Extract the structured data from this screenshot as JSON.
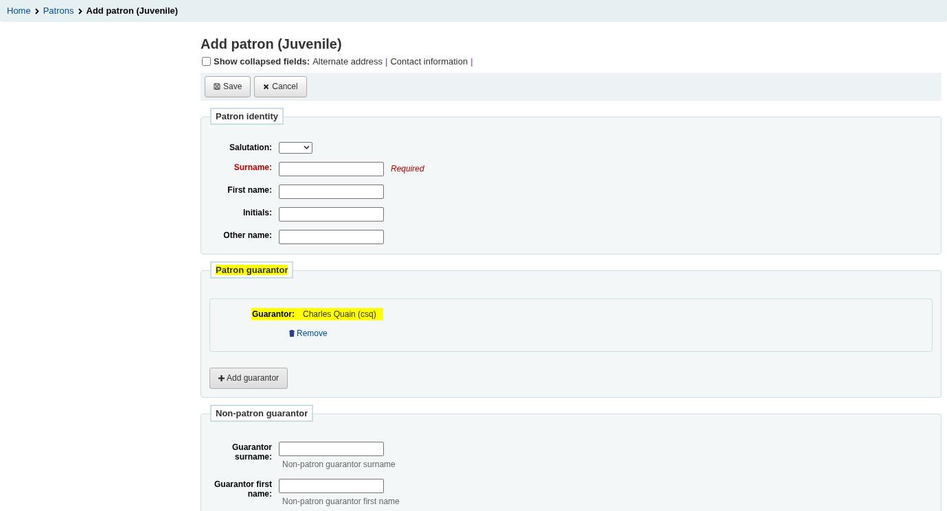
{
  "breadcrumb": [
    {
      "label": "Home",
      "link": true
    },
    {
      "label": "Patrons",
      "link": true
    },
    {
      "label": "Add patron (Juvenile)",
      "link": false
    }
  ],
  "title": "Add patron (Juvenile)",
  "collapsed": {
    "checked": false,
    "label": "Show collapsed fields:",
    "links": [
      "Alternate address",
      "Contact information"
    ],
    "separator": "|"
  },
  "toolbar": [
    {
      "label": "Save",
      "kind": "save"
    },
    {
      "label": "Cancel",
      "kind": "cancel"
    }
  ],
  "patron_identity": {
    "legend": "Patron identity",
    "highlighted": false,
    "fields": [
      {
        "label": "Salutation:",
        "kind": "select",
        "required": false
      },
      {
        "label": "Surname:",
        "kind": "text",
        "required": true,
        "note": "Required"
      },
      {
        "label": "First name:",
        "kind": "text",
        "required": false
      },
      {
        "label": "Initials:",
        "kind": "text",
        "required": false
      },
      {
        "label": "Other name:",
        "kind": "text",
        "required": false
      }
    ]
  },
  "patron_guarantor": {
    "legend": "Patron guarantor",
    "highlighted": true,
    "guarantor": {
      "label": "Guarantor:",
      "value": "Charles Quain (csq)",
      "highlighted": true,
      "remove": "Remove"
    },
    "add_button": "Add guarantor"
  },
  "non_patron_guarantor": {
    "legend": "Non-patron guarantor",
    "highlighted": false,
    "fields": [
      {
        "label": "Guarantor surname:",
        "kind": "text",
        "required": false,
        "hint": "Non-patron guarantor surname"
      },
      {
        "label": "Guarantor first name:",
        "kind": "text",
        "required": false,
        "hint": "Non-patron guarantor first name"
      }
    ]
  }
}
